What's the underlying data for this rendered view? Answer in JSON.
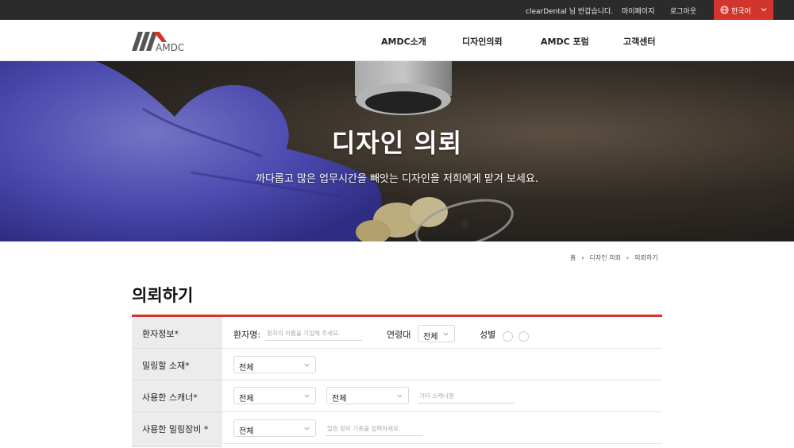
{
  "topbar": {
    "greeting": "clearDental 님 반갑습니다.",
    "mypage": "마이페이지",
    "logout": "로그아웃",
    "language": "한국어"
  },
  "header": {
    "logo_text": "AMDC",
    "nav": [
      "AMDC소개",
      "디자인의뢰",
      "AMDC 포럼",
      "고객센터"
    ]
  },
  "hero": {
    "title": "디자인 의뢰",
    "subtitle": "까다롭고 많은 업무시간을 빼앗는 디자인을 저희에게 맡겨 보세요."
  },
  "breadcrumb": [
    "홈",
    "디자인 의뢰",
    "의뢰하기"
  ],
  "page_title": "의뢰하기",
  "form": {
    "patient": {
      "label": "환자정보*",
      "name_label": "환자명:",
      "name_placeholder": "환자의 이름을 기입해 주세요.",
      "age_label": "연령대",
      "age_value": "전체",
      "gender_label": "성별"
    },
    "material": {
      "label": "밀링할 소재*",
      "value": "전체"
    },
    "scanner": {
      "label": "사용한 스캐너*",
      "value1": "전체",
      "value2": "전체",
      "other_placeholder": "기타 스캐너명"
    },
    "milling": {
      "label": "사용한 밀링장비 *",
      "value": "전체",
      "other_placeholder": "밀링 장비 기종을 입력하세요."
    }
  },
  "colors": {
    "accent": "#d2352b",
    "topbar_bg": "#2b2b2b",
    "label_bg": "#ececec"
  }
}
